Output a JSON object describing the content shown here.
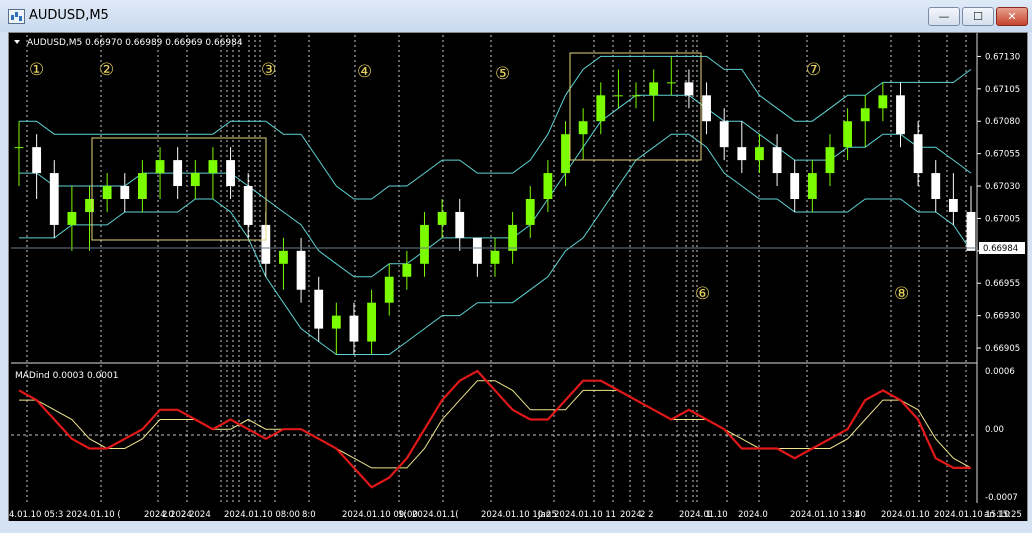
{
  "window": {
    "title": "AUDUSD,M5",
    "minimize_label": "—",
    "maximize_label": "☐",
    "close_label": "✕"
  },
  "main_panel": {
    "header": "AUDUSD,M5  0.66970 0.66989 0.66969 0.66984",
    "price_ticks": [
      "0.67130",
      "0.67105",
      "0.67080",
      "0.67055",
      "0.67030",
      "0.67005",
      "0.66980",
      "0.66955",
      "0.66930",
      "0.66905"
    ],
    "current_price": "0.66984",
    "markers": [
      "①",
      "②",
      "③",
      "④",
      "⑤",
      "⑥",
      "⑦",
      "⑧"
    ]
  },
  "indicator_panel": {
    "header": "MADind 0.0003 0.0001",
    "ticks": [
      "0.0006",
      "0.00",
      "-0.0007"
    ]
  },
  "time_axis": [
    "4.01.10 05:3",
    "2024.01.10 (",
    "2024.0",
    "2 2024",
    "2 2024",
    "2024.01.10 08:00",
    "8:0",
    "2024.01.10 09:00",
    "1(",
    "2024.01.1(",
    "2024.01.10 10:25",
    "Jan",
    "2024.01.10 11",
    "2024",
    "2 2",
    "2024.01.10",
    "1",
    "2024.0",
    "2024.01.10 13:40",
    "1",
    "2024.01.10",
    "2024.01.10 15:10",
    "an 15:25"
  ],
  "colors": {
    "background": "#000000",
    "bull_candle": "#7CFC00",
    "bear_candle": "#FFFFFF",
    "bands": "#5fd3d3",
    "boxes": "#e6d67a",
    "markers": "#e6d060",
    "mad_line": "#e01818",
    "signal_line": "#f0e68c",
    "grid": "#ffffff"
  },
  "chart_data": {
    "type": "candlestick",
    "candles": [
      [
        0.6706,
        0.6708,
        0.6703,
        0.6706
      ],
      [
        0.6706,
        0.6707,
        0.6702,
        0.6704
      ],
      [
        0.6704,
        0.6705,
        0.6699,
        0.67
      ],
      [
        0.67,
        0.6703,
        0.6698,
        0.6701
      ],
      [
        0.6701,
        0.6703,
        0.6698,
        0.6702
      ],
      [
        0.6702,
        0.6704,
        0.6701,
        0.6703
      ],
      [
        0.6703,
        0.6704,
        0.6701,
        0.6702
      ],
      [
        0.6702,
        0.6705,
        0.6701,
        0.6704
      ],
      [
        0.6704,
        0.6706,
        0.6702,
        0.6705
      ],
      [
        0.6705,
        0.6706,
        0.6702,
        0.6703
      ],
      [
        0.6703,
        0.6705,
        0.6702,
        0.6704
      ],
      [
        0.6704,
        0.6706,
        0.6702,
        0.6705
      ],
      [
        0.6705,
        0.6706,
        0.6702,
        0.6703
      ],
      [
        0.6703,
        0.6704,
        0.6699,
        0.67
      ],
      [
        0.67,
        0.6701,
        0.6696,
        0.6697
      ],
      [
        0.6697,
        0.6699,
        0.6695,
        0.6698
      ],
      [
        0.6698,
        0.6699,
        0.6694,
        0.6695
      ],
      [
        0.6695,
        0.6696,
        0.6691,
        0.6692
      ],
      [
        0.6692,
        0.6694,
        0.669,
        0.6693
      ],
      [
        0.6693,
        0.6694,
        0.669,
        0.6691
      ],
      [
        0.6691,
        0.6695,
        0.669,
        0.6694
      ],
      [
        0.6694,
        0.6697,
        0.6693,
        0.6696
      ],
      [
        0.6696,
        0.6698,
        0.6695,
        0.6697
      ],
      [
        0.6697,
        0.6701,
        0.6696,
        0.67
      ],
      [
        0.67,
        0.6702,
        0.6699,
        0.6701
      ],
      [
        0.6701,
        0.6702,
        0.6698,
        0.6699
      ],
      [
        0.6699,
        0.6699,
        0.6696,
        0.6697
      ],
      [
        0.6697,
        0.6699,
        0.6696,
        0.6698
      ],
      [
        0.6698,
        0.6701,
        0.6697,
        0.67
      ],
      [
        0.67,
        0.6703,
        0.6699,
        0.6702
      ],
      [
        0.6702,
        0.6705,
        0.6701,
        0.6704
      ],
      [
        0.6704,
        0.6708,
        0.6703,
        0.6707
      ],
      [
        0.6707,
        0.6709,
        0.6705,
        0.6708
      ],
      [
        0.6708,
        0.6711,
        0.6707,
        0.671
      ],
      [
        0.671,
        0.6712,
        0.6709,
        0.671
      ],
      [
        0.671,
        0.6711,
        0.6709,
        0.671
      ],
      [
        0.671,
        0.6712,
        0.6708,
        0.6711
      ],
      [
        0.6711,
        0.6713,
        0.671,
        0.6711
      ],
      [
        0.6711,
        0.6712,
        0.6709,
        0.671
      ],
      [
        0.671,
        0.6711,
        0.6707,
        0.6708
      ],
      [
        0.6708,
        0.6709,
        0.6705,
        0.6706
      ],
      [
        0.6706,
        0.6708,
        0.6704,
        0.6705
      ],
      [
        0.6705,
        0.6707,
        0.6704,
        0.6706
      ],
      [
        0.6706,
        0.6707,
        0.6703,
        0.6704
      ],
      [
        0.6704,
        0.6705,
        0.6701,
        0.6702
      ],
      [
        0.6702,
        0.6705,
        0.6701,
        0.6704
      ],
      [
        0.6704,
        0.6707,
        0.6703,
        0.6706
      ],
      [
        0.6706,
        0.6709,
        0.6705,
        0.6708
      ],
      [
        0.6708,
        0.671,
        0.6706,
        0.6709
      ],
      [
        0.6709,
        0.6711,
        0.6708,
        0.671
      ],
      [
        0.671,
        0.6711,
        0.6706,
        0.6707
      ],
      [
        0.6707,
        0.6708,
        0.6703,
        0.6704
      ],
      [
        0.6704,
        0.6705,
        0.6701,
        0.6702
      ],
      [
        0.6702,
        0.6704,
        0.67,
        0.6701
      ],
      [
        0.6701,
        0.6703,
        0.6699,
        0.6698
      ]
    ],
    "bands": {
      "upper": [
        0.6708,
        0.6708,
        0.6707,
        0.6707,
        0.6707,
        0.6707,
        0.6707,
        0.6707,
        0.6707,
        0.6707,
        0.6707,
        0.6707,
        0.6708,
        0.6708,
        0.6708,
        0.6707,
        0.6707,
        0.6705,
        0.6703,
        0.6702,
        0.6702,
        0.6703,
        0.6703,
        0.6704,
        0.6705,
        0.6705,
        0.6704,
        0.6704,
        0.6704,
        0.6705,
        0.6707,
        0.671,
        0.6712,
        0.6713,
        0.6713,
        0.6713,
        0.6713,
        0.6713,
        0.6713,
        0.6713,
        0.6712,
        0.6712,
        0.671,
        0.6709,
        0.6708,
        0.6708,
        0.6709,
        0.671,
        0.671,
        0.6711,
        0.6711,
        0.6711,
        0.6711,
        0.6711,
        0.6712
      ],
      "middle": [
        0.6704,
        0.6704,
        0.6703,
        0.6703,
        0.6703,
        0.6703,
        0.6703,
        0.6704,
        0.6704,
        0.6704,
        0.6704,
        0.6704,
        0.6704,
        0.6703,
        0.6702,
        0.6701,
        0.67,
        0.6698,
        0.6697,
        0.6696,
        0.6696,
        0.6697,
        0.6697,
        0.6698,
        0.6699,
        0.6699,
        0.6699,
        0.6699,
        0.6699,
        0.67,
        0.6702,
        0.6704,
        0.6706,
        0.6708,
        0.6709,
        0.671,
        0.671,
        0.671,
        0.671,
        0.6709,
        0.6708,
        0.6708,
        0.6707,
        0.6706,
        0.6705,
        0.6705,
        0.6705,
        0.6706,
        0.6706,
        0.6707,
        0.6707,
        0.6706,
        0.6706,
        0.6705,
        0.6704
      ],
      "lower": [
        0.6699,
        0.6699,
        0.6699,
        0.67,
        0.67,
        0.67,
        0.6701,
        0.6701,
        0.6701,
        0.6701,
        0.6702,
        0.6702,
        0.6701,
        0.6699,
        0.6696,
        0.6694,
        0.6692,
        0.6691,
        0.669,
        0.669,
        0.669,
        0.669,
        0.6691,
        0.6692,
        0.6693,
        0.6693,
        0.6694,
        0.6694,
        0.6694,
        0.6695,
        0.6696,
        0.6698,
        0.6699,
        0.6701,
        0.6703,
        0.6705,
        0.6706,
        0.6707,
        0.6707,
        0.6706,
        0.6704,
        0.6703,
        0.6702,
        0.6702,
        0.6701,
        0.6701,
        0.6701,
        0.6701,
        0.6702,
        0.6702,
        0.6702,
        0.6701,
        0.6701,
        0.67,
        0.6698
      ]
    },
    "mad": [
      0.0004,
      0.0003,
      0.0001,
      -0.0001,
      -0.0002,
      -0.0002,
      -0.0001,
      0,
      0.0002,
      0.0002,
      0.0001,
      0,
      0.0001,
      0,
      -0.0001,
      0,
      0,
      -0.0001,
      -0.0002,
      -0.0004,
      -0.0006,
      -0.0005,
      -0.0003,
      0,
      0.0003,
      0.0005,
      0.0006,
      0.0004,
      0.0002,
      0.0001,
      0.0001,
      0.0003,
      0.0005,
      0.0005,
      0.0004,
      0.0003,
      0.0002,
      0.0001,
      0.0002,
      0.0001,
      0,
      -0.0002,
      -0.0002,
      -0.0002,
      -0.0003,
      -0.0002,
      -0.0001,
      0,
      0.0003,
      0.0004,
      0.0003,
      0.0001,
      -0.0003,
      -0.0004,
      -0.0004
    ],
    "signal": [
      0.0003,
      0.0003,
      0.0002,
      0.0001,
      -0.0001,
      -0.0002,
      -0.0002,
      -0.0001,
      0.0001,
      0.0001,
      0.0001,
      0,
      0,
      0.0001,
      0,
      0,
      0,
      -0.0001,
      -0.0002,
      -0.0003,
      -0.0004,
      -0.0004,
      -0.0004,
      -0.0002,
      0.0001,
      0.0003,
      0.0005,
      0.0005,
      0.0004,
      0.0002,
      0.0002,
      0.0002,
      0.0004,
      0.0004,
      0.0004,
      0.0003,
      0.0002,
      0.0001,
      0.0001,
      0.0001,
      0,
      -0.0001,
      -0.0002,
      -0.0002,
      -0.0002,
      -0.0002,
      -0.0002,
      -0.0001,
      0.0001,
      0.0003,
      0.0003,
      0.0002,
      -0.0001,
      -0.0003,
      -0.0004
    ],
    "ylim": [
      0.66895,
      0.67145
    ],
    "indicator_ylim": [
      -0.0007,
      0.0006
    ]
  }
}
